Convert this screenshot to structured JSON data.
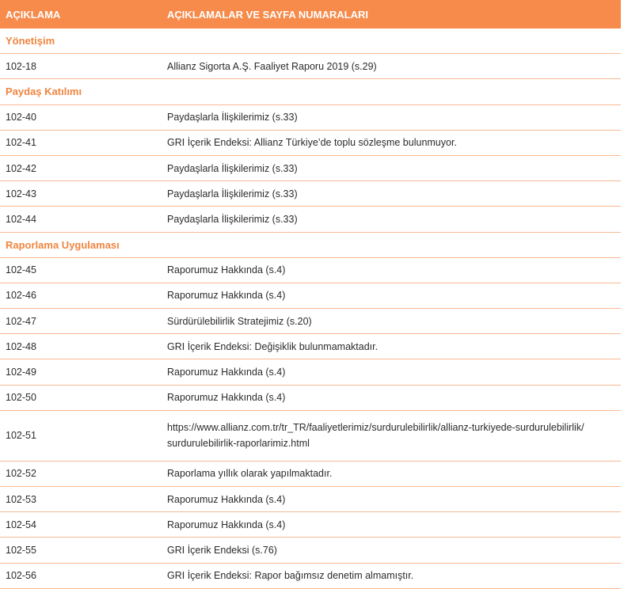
{
  "header": {
    "col1": "AÇIKLAMA",
    "col2": "AÇIKLAMALAR VE SAYFA NUMARALARI"
  },
  "colors": {
    "header_bg": "#F68B4B",
    "section_text": "#F08540",
    "divider": "#F7B993"
  },
  "rows": [
    {
      "type": "section",
      "code": "Yönetişim",
      "text": ""
    },
    {
      "type": "row",
      "code": "102-18",
      "text": "Allianz Sigorta A.Ş. Faaliyet Raporu 2019 (s.29)"
    },
    {
      "type": "section",
      "code": "Paydaş Katılımı",
      "text": ""
    },
    {
      "type": "row",
      "code": "102-40",
      "text": "Paydaşlarla İlişkilerimiz (s.33)"
    },
    {
      "type": "row",
      "code": "102-41",
      "text": "GRI İçerik Endeksi: Allianz Türkiye’de toplu sözleşme bulunmuyor."
    },
    {
      "type": "row",
      "code": "102-42",
      "text": "Paydaşlarla İlişkilerimiz (s.33)"
    },
    {
      "type": "row",
      "code": "102-43",
      "text": "Paydaşlarla İlişkilerimiz (s.33)"
    },
    {
      "type": "row",
      "code": "102-44",
      "text": "Paydaşlarla İlişkilerimiz (s.33)"
    },
    {
      "type": "section",
      "code": "Raporlama Uygulaması",
      "text": ""
    },
    {
      "type": "row",
      "code": "102-45",
      "text": "Raporumuz Hakkında (s.4)"
    },
    {
      "type": "row",
      "code": "102-46",
      "text": "Raporumuz Hakkında (s.4)"
    },
    {
      "type": "row",
      "code": "102-47",
      "text": "Sürdürülebilirlik Stratejimiz (s.20)"
    },
    {
      "type": "row",
      "code": "102-48",
      "text": "GRI İçerik Endeksi: Değişiklik bulunmamaktadır."
    },
    {
      "type": "row",
      "code": "102-49",
      "text": "Raporumuz Hakkında (s.4)"
    },
    {
      "type": "row",
      "code": "102-50",
      "text": "Raporumuz Hakkında (s.4)"
    },
    {
      "type": "link",
      "code": "102-51",
      "text": "https://www.allianz.com.tr/tr_TR/faaliyetlerimiz/surdurulebilirlik/allianz-turkiyede-surdurulebilirlik/",
      "text2": "surdurulebilirlik-raporlarimiz.html"
    },
    {
      "type": "row",
      "code": "102-52",
      "text": "Raporlama yıllık olarak yapılmaktadır."
    },
    {
      "type": "row",
      "code": "102-53",
      "text": "Raporumuz Hakkında (s.4)"
    },
    {
      "type": "row",
      "code": "102-54",
      "text": "Raporumuz Hakkında (s.4)"
    },
    {
      "type": "row",
      "code": "102-55",
      "text": "GRI İçerik Endeksi (s.76)"
    },
    {
      "type": "row",
      "code": "102-56",
      "text": "GRI İçerik Endeksi: Rapor bağımsız denetim almamıştır."
    }
  ]
}
